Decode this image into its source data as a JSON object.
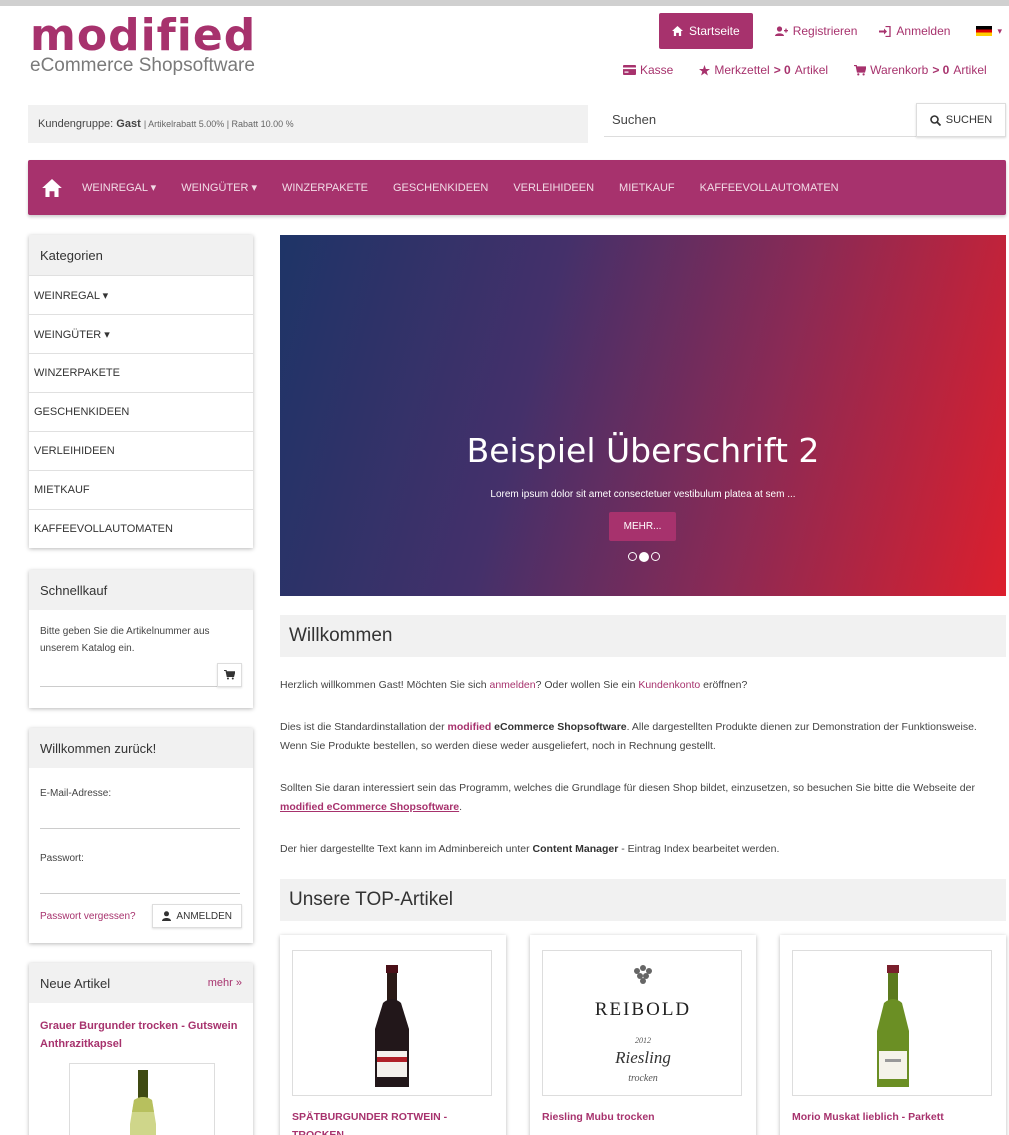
{
  "logo": {
    "word": "modified",
    "sub": "eCommerce Shopsoftware"
  },
  "topnav": {
    "home": "Startseite",
    "register": "Registrieren",
    "login": "Anmelden"
  },
  "subnav": {
    "checkout": "Kasse",
    "wishlist_label": "Merkzettel",
    "wishlist_count": "> 0",
    "wishlist_unit": "Artikel",
    "cart_label": "Warenkorb",
    "cart_count": "> 0",
    "cart_unit": "Artikel"
  },
  "groupbar": {
    "label": "Kundengruppe:",
    "group": "Gast",
    "details": "| Artikelrabatt 5.00% | Rabatt 10.00 %"
  },
  "search": {
    "placeholder": "Suchen",
    "button": "SUCHEN"
  },
  "mainmenu": [
    "WEINREGAL ▾",
    "WEINGÜTER ▾",
    "WINZERPAKETE",
    "GESCHENKIDEEN",
    "VERLEIHIDEEN",
    "MIETKAUF",
    "KAFFEEVOLLAUTOMATEN"
  ],
  "categories": {
    "title": "Kategorien",
    "items": [
      "WEINREGAL ▾",
      "WEINGÜTER ▾",
      "WINZERPAKETE",
      "GESCHENKIDEEN",
      "VERLEIHIDEEN",
      "MIETKAUF",
      "KAFFEEVOLLAUTOMATEN"
    ]
  },
  "quickbuy": {
    "title": "Schnellkauf",
    "text": "Bitte geben Sie die Artikelnummer aus unserem Katalog ein."
  },
  "login_box": {
    "title": "Willkommen zurück!",
    "email_label": "E-Mail-Adresse:",
    "password_label": "Passwort:",
    "forgot": "Passwort vergessen?",
    "button": "ANMELDEN"
  },
  "new_articles": {
    "title": "Neue Artikel",
    "more": "mehr »",
    "item_title": "Grauer Burgunder trocken - Gutswein Anthrazitkapsel"
  },
  "hero": {
    "title": "Beispiel Überschrift 2",
    "subtitle": "Lorem ipsum dolor sit amet consectetuer vestibulum platea at sem ...",
    "button": "MEHR..."
  },
  "welcome": {
    "heading": "Willkommen",
    "p1_a": "Herzlich willkommen Gast! Möchten Sie sich ",
    "p1_link1": "anmelden",
    "p1_b": "? Oder wollen Sie ein ",
    "p1_link2": "Kundenkonto",
    "p1_c": " eröffnen?",
    "p2_a": "Dies ist die Standardinstallation der ",
    "p2_brand_pre": "modified",
    "p2_brand_post": " eCommerce Shopsoftware",
    "p2_b": ". Alle dargestellten Produkte dienen zur Demonstration der Funktionsweise. Wenn Sie Produkte bestellen, so werden diese weder ausgeliefert, noch in Rechnung gestellt.",
    "p3_a": "Sollten Sie daran interessiert sein das Programm, welches die Grundlage für diesen Shop bildet, einzusetzen, so besuchen Sie bitte die Webseite der ",
    "p3_link": "modified eCommerce Shopsoftware",
    "p3_b": ".",
    "p4_a": "Der hier dargestellte Text kann im Adminbereich unter ",
    "p4_bold": "Content Manager",
    "p4_b": " - Eintrag Index bearbeitet werden."
  },
  "top_articles": {
    "heading": "Unsere TOP-Artikel",
    "items": [
      {
        "name": "SPÄTBURGUNDER ROTWEIN - TROCKEN"
      },
      {
        "name": "Riesling Mubu trocken",
        "label_brand": "REIBOLD",
        "label_year": "2012",
        "label_wine": "Riesling",
        "label_style": "trocken"
      },
      {
        "name": "Morio Muskat lieblich - Parkett"
      }
    ]
  },
  "colors": {
    "brand": "#a7326d",
    "panel": "#f1f1f1"
  }
}
